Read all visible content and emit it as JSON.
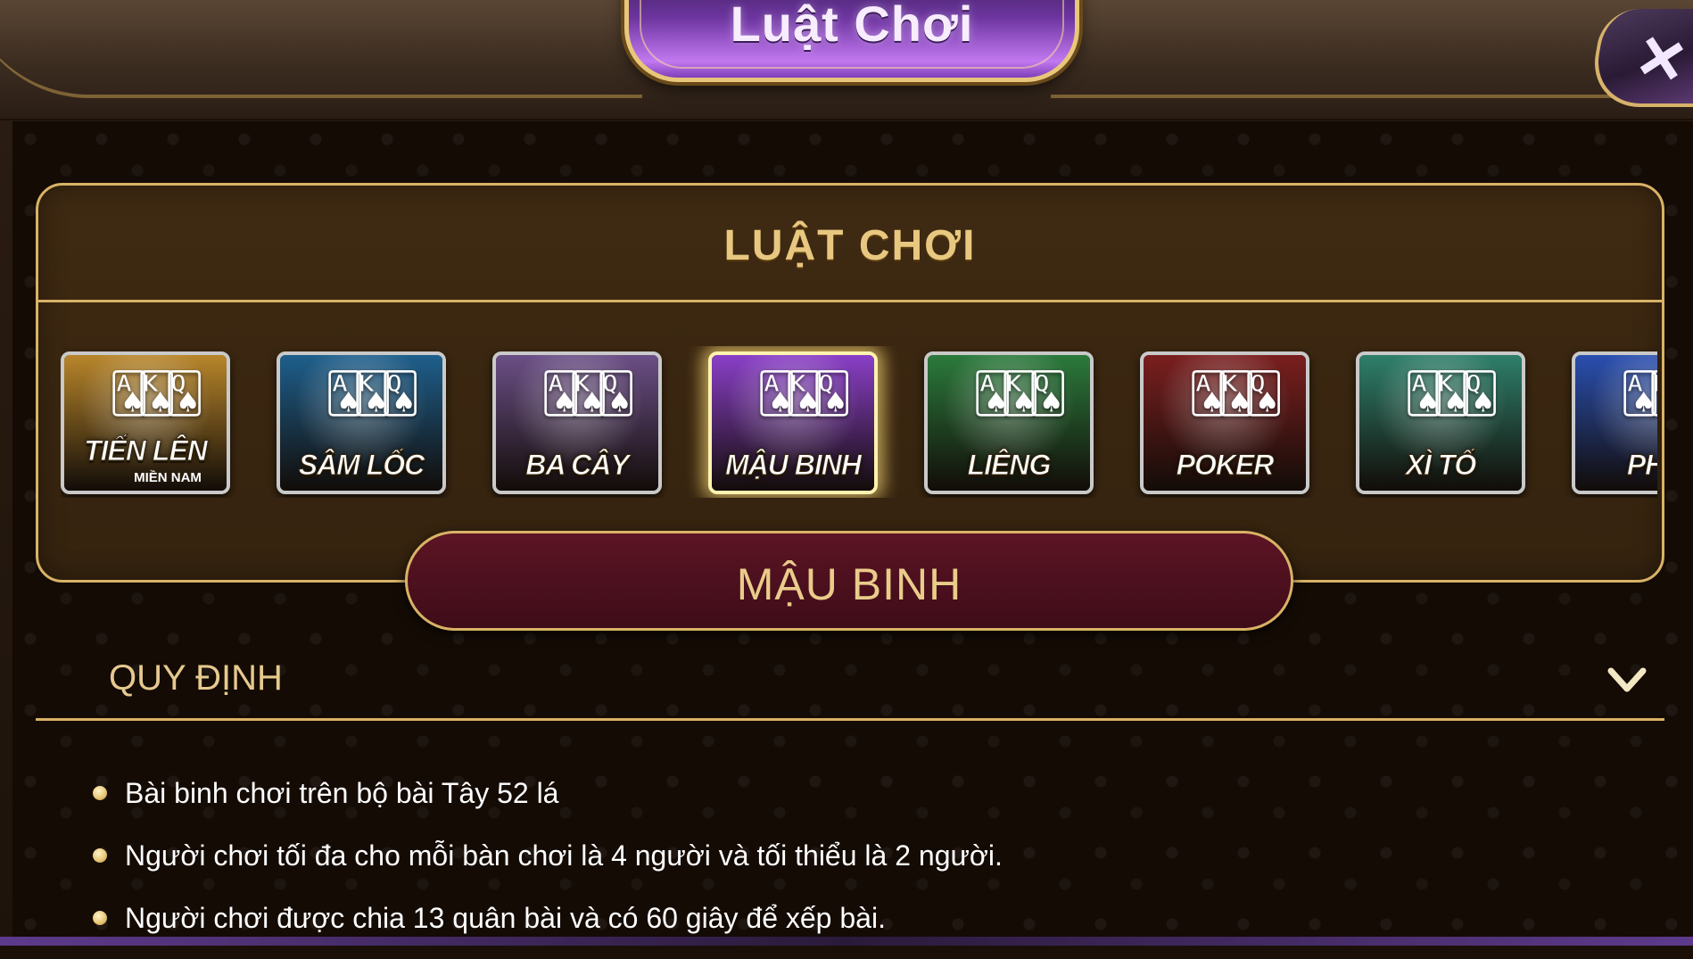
{
  "window": {
    "title": "Luật Chơi",
    "close_icon": "close-icon"
  },
  "panel": {
    "title": "LUẬT CHƠI",
    "games": [
      {
        "label": "TIẾN LÊN",
        "sublabel": "MIỀN NAM",
        "icon": "tien-len-mien-nam-icon",
        "accent": "#b8862b",
        "selected": false
      },
      {
        "label": "SÂM LỐC",
        "sublabel": "",
        "icon": "sam-loc-icon",
        "accent": "#1e5f8c",
        "selected": false
      },
      {
        "label": "BA CÂY",
        "sublabel": "",
        "icon": "ba-cay-icon",
        "accent": "#6b4f86",
        "selected": false
      },
      {
        "label": "MẬU BINH",
        "sublabel": "",
        "icon": "mau-binh-icon",
        "accent": "#8a3fc8",
        "selected": true
      },
      {
        "label": "LIÊNG",
        "sublabel": "",
        "icon": "lieng-icon",
        "accent": "#2b7a3c",
        "selected": false
      },
      {
        "label": "POKER",
        "sublabel": "",
        "icon": "poker-icon",
        "accent": "#7a1f1f",
        "selected": false
      },
      {
        "label": "XÌ TỐ",
        "sublabel": "",
        "icon": "xi-to-icon",
        "accent": "#2e7f6a",
        "selected": false
      },
      {
        "label": "PHỎ",
        "sublabel": "",
        "icon": "pho-icon",
        "accent": "#2a4fb0",
        "selected": false
      }
    ]
  },
  "selected_game": {
    "name": "MẬU BINH"
  },
  "section": {
    "title": "QUY ĐỊNH",
    "expand_icon": "chevron-down-icon",
    "rules": [
      "Bài binh chơi trên bộ bài Tây 52 lá",
      "Người chơi tối đa cho mỗi bàn chơi là 4 người và tối thiểu là 2 người.",
      "Người chơi được chia 13 quân bài và có 60 giây để xếp bài."
    ]
  },
  "colors": {
    "gold": "#d9b266",
    "gold_text": "#e8c880",
    "panel_bg": "#3f2a12",
    "pill_bg": "#5c1424",
    "title_purple": "#8a45c8"
  }
}
